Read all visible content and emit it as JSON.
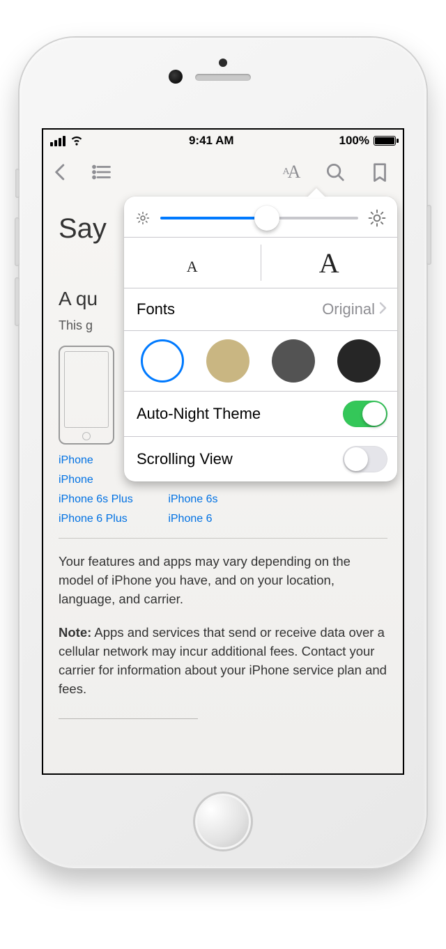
{
  "status": {
    "time": "9:41 AM",
    "battery_pct": "100%"
  },
  "page": {
    "title_visible": "Say",
    "subtitle_visible": "A qu",
    "intro_visible": "This g",
    "links": [
      "iPhone",
      "iPhone",
      "iPhone 6s Plus",
      "iPhone 6s",
      "iPhone 6 Plus",
      "iPhone 6"
    ],
    "para1": "Your features and apps may vary depending on the model of iPhone you have, and on your location, language, and carrier.",
    "note_label": "Note:",
    "para2": "Apps and services that send or receive data over a cellular network may incur additional fees. Contact your carrier for information about your iPhone service plan and fees."
  },
  "popover": {
    "brightness_pct": 54,
    "size_small": "A",
    "size_large": "A",
    "fonts_label": "Fonts",
    "fonts_value": "Original",
    "themes": [
      {
        "name": "white",
        "hex": "#ffffff",
        "selected": true
      },
      {
        "name": "sepia",
        "hex": "#c9b682",
        "selected": false
      },
      {
        "name": "gray",
        "hex": "#535353",
        "selected": false
      },
      {
        "name": "black",
        "hex": "#262626",
        "selected": false
      }
    ],
    "auto_night_label": "Auto-Night Theme",
    "auto_night_on": true,
    "scrolling_label": "Scrolling View",
    "scrolling_on": false
  }
}
